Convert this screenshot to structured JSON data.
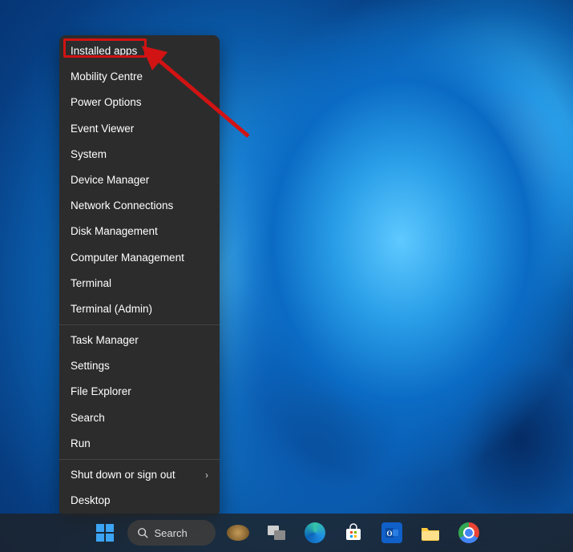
{
  "context_menu": {
    "group1": [
      "Installed apps",
      "Mobility Centre",
      "Power Options",
      "Event Viewer",
      "System",
      "Device Manager",
      "Network Connections",
      "Disk Management",
      "Computer Management",
      "Terminal",
      "Terminal (Admin)"
    ],
    "group2": [
      "Task Manager",
      "Settings",
      "File Explorer",
      "Search",
      "Run"
    ],
    "group3": [
      {
        "label": "Shut down or sign out",
        "submenu": true
      },
      {
        "label": "Desktop",
        "submenu": false
      }
    ],
    "highlighted": "Installed apps"
  },
  "taskbar": {
    "search_placeholder": "Search",
    "icons": [
      "start",
      "search",
      "widgets",
      "task-view",
      "edge",
      "store",
      "outlook",
      "file-explorer",
      "chrome"
    ]
  }
}
